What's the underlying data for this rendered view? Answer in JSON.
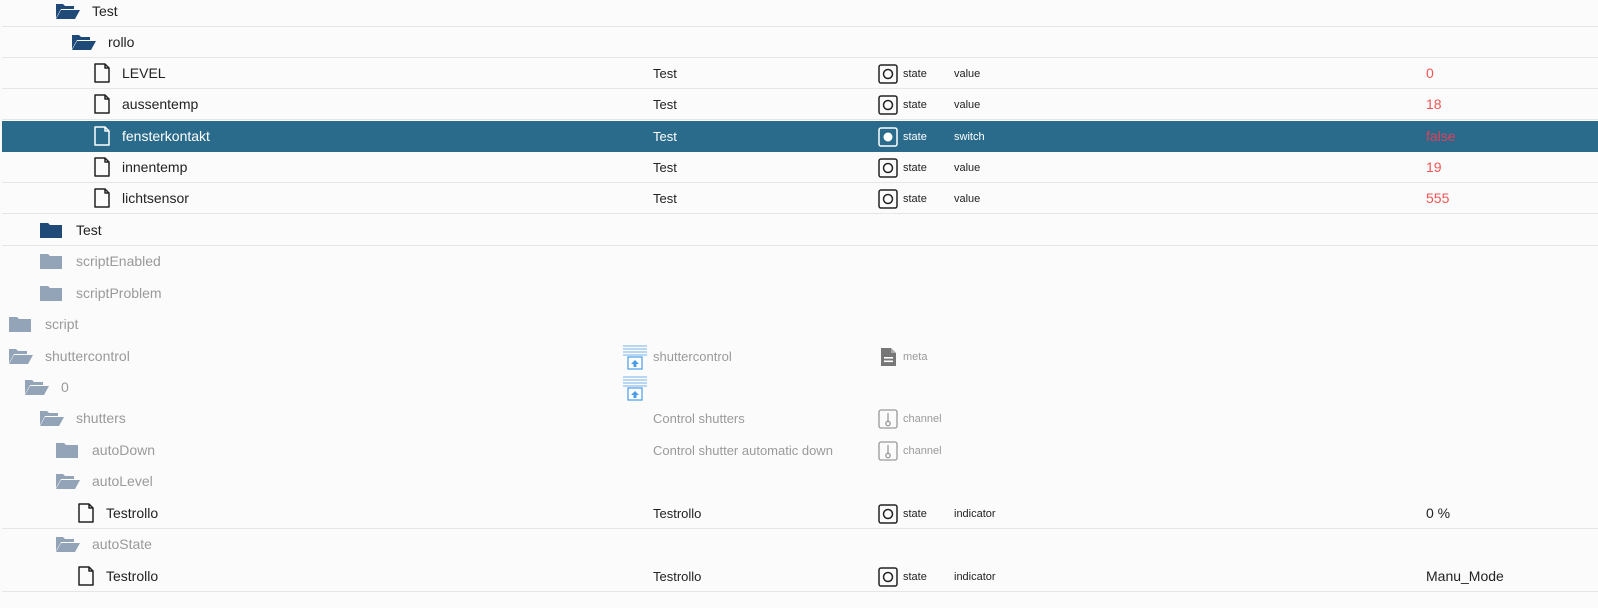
{
  "colors": {
    "selected_row_bg": "#2a6b8c",
    "folder_dark": "#1f4a78",
    "folder_dim": "#93a3b8",
    "value_number": "#f05555",
    "dim_text": "#9a9a9a",
    "script_icon": "#4a9ce8"
  },
  "rows": [
    {
      "name": "Test",
      "icon": "folder-open-icon"
    },
    {
      "name": "rollo",
      "icon": "folder-open-icon"
    },
    {
      "name": "LEVEL",
      "icon": "file-icon",
      "desc": "Test",
      "type": "state",
      "role": "value",
      "value": "0"
    },
    {
      "name": "aussentemp",
      "icon": "file-icon",
      "desc": "Test",
      "type": "state",
      "role": "value",
      "value": "18"
    },
    {
      "name": "fensterkontakt",
      "icon": "file-icon",
      "desc": "Test",
      "type": "state",
      "role": "switch",
      "value": "false"
    },
    {
      "name": "innentemp",
      "icon": "file-icon",
      "desc": "Test",
      "type": "state",
      "role": "value",
      "value": "19"
    },
    {
      "name": "lichtsensor",
      "icon": "file-icon",
      "desc": "Test",
      "type": "state",
      "role": "value",
      "value": "555"
    },
    {
      "name": "Test",
      "icon": "folder-icon"
    },
    {
      "name": "scriptEnabled",
      "icon": "folder-icon"
    },
    {
      "name": "scriptProblem",
      "icon": "folder-icon"
    },
    {
      "name": "script",
      "icon": "folder-icon"
    },
    {
      "name": "shuttercontrol",
      "icon": "folder-open-icon",
      "desc": "shuttercontrol",
      "type": "meta",
      "extra_icon": "shutter-adapter-icon"
    },
    {
      "name": "0",
      "icon": "folder-open-icon",
      "extra_icon": "shutter-adapter-icon"
    },
    {
      "name": "shutters",
      "icon": "folder-open-icon",
      "desc": "Control shutters",
      "type": "channel"
    },
    {
      "name": "autoDown",
      "icon": "folder-icon",
      "desc": "Control shutter automatic down",
      "type": "channel"
    },
    {
      "name": "autoLevel",
      "icon": "folder-open-icon"
    },
    {
      "name": "Testrollo",
      "icon": "file-icon",
      "desc": "Testrollo",
      "type": "state",
      "role": "indicator",
      "value": "0 %"
    },
    {
      "name": "autoState",
      "icon": "folder-open-icon"
    },
    {
      "name": "Testrollo",
      "icon": "file-icon",
      "desc": "Testrollo",
      "type": "state",
      "role": "indicator",
      "value": "Manu_Mode"
    }
  ]
}
